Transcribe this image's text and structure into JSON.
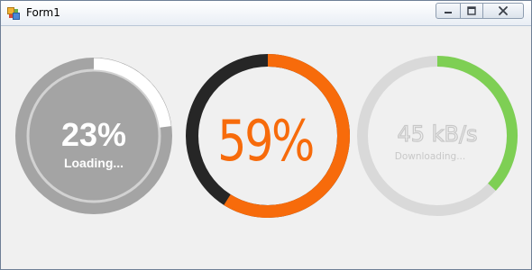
{
  "window": {
    "title": "Form1"
  },
  "gauges": [
    {
      "percent": 23,
      "value_text": "23%",
      "sub_text": "Loading...",
      "colors": {
        "disc": "#a4a4a4",
        "track": "#a4a4a4",
        "progress": "#ffffff",
        "inner_ring": "#d2d2d2",
        "text": "#ffffff"
      }
    },
    {
      "percent": 59,
      "value_text": "59%",
      "colors": {
        "track": "#262626",
        "progress": "#f76b0b",
        "text": "#f76b0b"
      }
    },
    {
      "percent": 37,
      "value_text": "45 kB/s",
      "sub_text": "Downloading...",
      "colors": {
        "track": "#d9d9d9",
        "progress": "#7ecf54",
        "text": "#c8c8c8"
      }
    }
  ]
}
